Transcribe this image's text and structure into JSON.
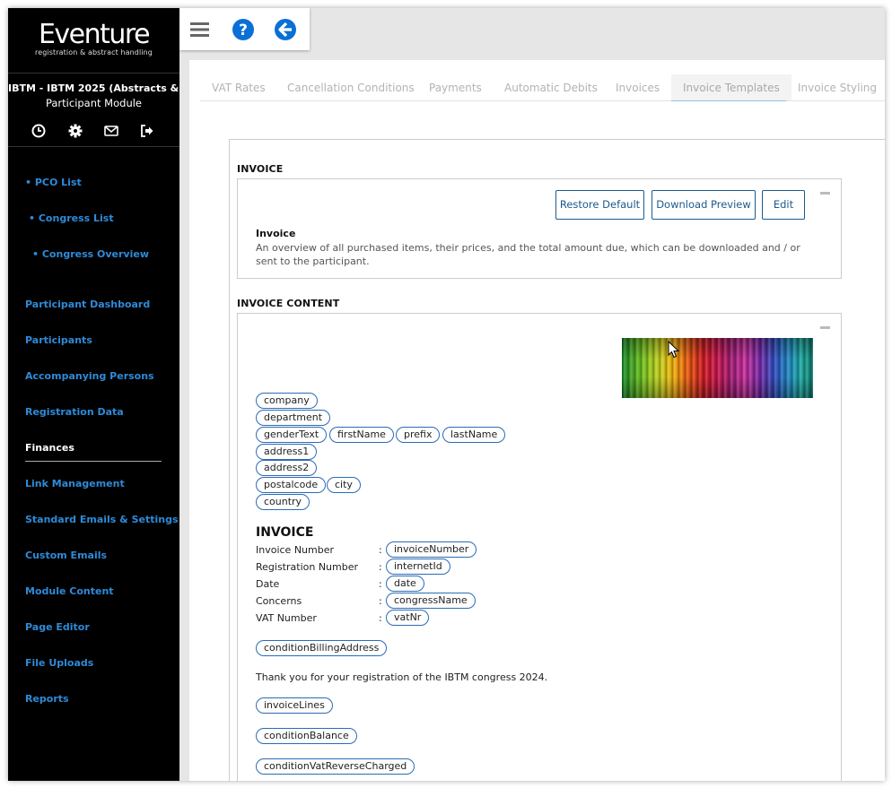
{
  "app": {
    "logo_text": "Eventure",
    "logo_tagline": "registration & abstract handling",
    "congress_name": "IBTM - IBTM 2025 (Abstracts & Par...",
    "module_name": "Participant Module"
  },
  "sidebar": {
    "icons": [
      "clock-icon",
      "gear-icon",
      "envelope-icon",
      "logout-icon"
    ],
    "top_links": [
      "• PCO List",
      "• Congress List",
      "• Congress Overview"
    ],
    "items": [
      "Participant Dashboard",
      "Participants",
      "Accompanying Persons",
      "Registration Data",
      "Finances",
      "Link Management",
      "Standard Emails & Settings",
      "Custom Emails",
      "Module Content",
      "Page Editor",
      "File Uploads",
      "Reports"
    ],
    "active_item": "Finances"
  },
  "toolbar": {
    "icons": [
      "hamburger-menu-icon",
      "help-icon",
      "back-arrow-icon"
    ],
    "accent_color": "#0a6fd6"
  },
  "tabs": [
    {
      "label": "VAT Rates"
    },
    {
      "label": "Cancellation Conditions"
    },
    {
      "label": "Payments"
    },
    {
      "label": "Automatic Debits"
    },
    {
      "label": "Invoices"
    },
    {
      "label": "Invoice Templates"
    },
    {
      "label": "Invoice Styling"
    }
  ],
  "active_tab": "Invoice Templates",
  "invoice_section": {
    "title": "INVOICE",
    "buttons": {
      "restore": "Restore Default",
      "download": "Download Preview",
      "edit": "Edit"
    },
    "item_title": "Invoice",
    "item_description": "An overview of all purchased items, their prices, and the total amount due, which can be downloaded and / or sent to the participant."
  },
  "content_section": {
    "title": "INVOICE CONTENT",
    "address_tags": {
      "company": "company",
      "department": "department",
      "genderText": "genderText",
      "firstName": "firstName",
      "prefix": "prefix",
      "lastName": "lastName",
      "address1": "address1",
      "address2": "address2",
      "postalcode": "postalcode",
      "city": "city",
      "country": "country"
    },
    "heading": "INVOICE",
    "fields": [
      {
        "label": "Invoice Number",
        "tag": "invoiceNumber"
      },
      {
        "label": "Registration Number",
        "tag": "internetId"
      },
      {
        "label": "Date",
        "tag": "date"
      },
      {
        "label": "Concerns",
        "tag": "congressName"
      },
      {
        "label": "VAT Number",
        "tag": "vatNr"
      }
    ],
    "colon": ":",
    "condition_billing": "conditionBillingAddress",
    "thank_you": "Thank you for your registration of the IBTM congress 2024.",
    "invoice_lines": "invoiceLines",
    "condition_balance": "conditionBalance",
    "condition_vat": "conditionVatReverseCharged"
  }
}
